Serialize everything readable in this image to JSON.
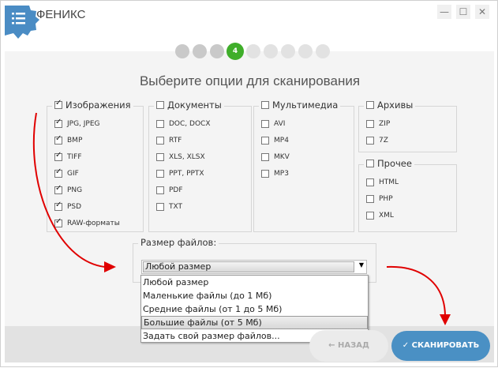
{
  "window": {
    "title": "ФЕНИКС",
    "minimize": "—",
    "maximize": "☐",
    "close": "✕"
  },
  "steps": {
    "current": 4,
    "total": 9,
    "current_label": "4"
  },
  "heading": "Выберите опции для сканирования",
  "groups": {
    "images": {
      "label": "Изображения",
      "checked": true,
      "items": [
        {
          "label": "JPG, JPEG",
          "checked": true
        },
        {
          "label": "BMP",
          "checked": true
        },
        {
          "label": "TIFF",
          "checked": true
        },
        {
          "label": "GIF",
          "checked": true
        },
        {
          "label": "PNG",
          "checked": true
        },
        {
          "label": "PSD",
          "checked": true
        },
        {
          "label": "RAW-форматы",
          "checked": true
        }
      ]
    },
    "documents": {
      "label": "Документы",
      "checked": false,
      "items": [
        {
          "label": "DOC, DOCX"
        },
        {
          "label": "RTF"
        },
        {
          "label": "XLS, XLSX"
        },
        {
          "label": "PPT, PPTX"
        },
        {
          "label": "PDF"
        },
        {
          "label": "TXT"
        }
      ]
    },
    "multimedia": {
      "label": "Мультимедиа",
      "checked": false,
      "items": [
        {
          "label": "AVI"
        },
        {
          "label": "MP4"
        },
        {
          "label": "MKV"
        },
        {
          "label": "MP3"
        }
      ]
    },
    "archives": {
      "label": "Архивы",
      "checked": false,
      "items": [
        {
          "label": "ZIP"
        },
        {
          "label": "7Z"
        }
      ]
    },
    "other": {
      "label": "Прочее",
      "checked": false,
      "items": [
        {
          "label": "HTML"
        },
        {
          "label": "PHP"
        },
        {
          "label": "XML"
        }
      ]
    }
  },
  "size": {
    "label": "Размер файлов:",
    "selected": "Любой размер",
    "options": [
      "Любой размер",
      "Маленькие файлы (до 1 Мб)",
      "Средние файлы (от 1 до 5 Мб)",
      "Большие файлы (от 5 Мб)",
      "Задать свой размер файлов..."
    ],
    "highlighted_index": 3
  },
  "buttons": {
    "back": "← НАЗАД",
    "scan": "✓ СКАНИРОВАТЬ"
  },
  "colors": {
    "accent": "#4a90c4",
    "step_active": "#3fae2a",
    "arrow": "#e00000"
  }
}
